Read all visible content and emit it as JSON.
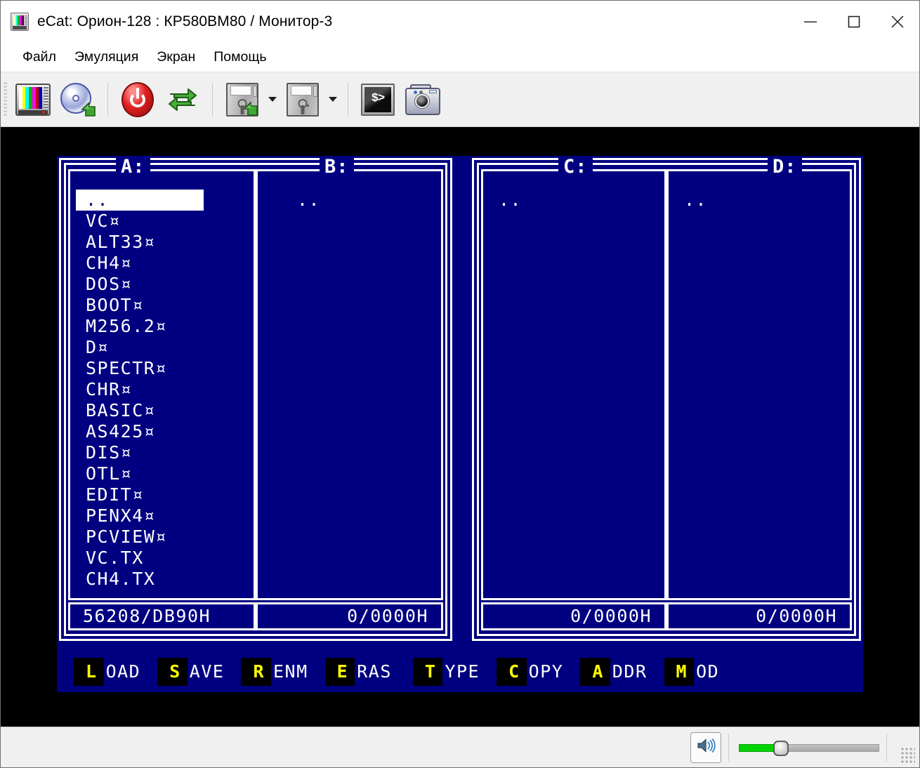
{
  "window": {
    "title": "eCat: Орион-128 : КР580ВМ80 / Монитор-3",
    "app_icon": "tv-monitor-icon",
    "controls": {
      "minimize": "minimize-icon",
      "maximize": "maximize-icon",
      "close": "close-icon"
    }
  },
  "menubar": {
    "items": [
      {
        "label": "Файл"
      },
      {
        "label": "Эмуляция"
      },
      {
        "label": "Экран"
      },
      {
        "label": "Помощь"
      }
    ]
  },
  "toolbar": {
    "buttons": [
      {
        "icon": "tv-monitor-icon",
        "name": "screen-settings-button"
      },
      {
        "icon": "cd-load-icon",
        "name": "load-disk-image-button"
      },
      {
        "icon": "power-icon",
        "name": "power-button"
      },
      {
        "icon": "reset-sync-icon",
        "name": "reset-button"
      },
      {
        "icon": "floppy-load-icon",
        "name": "mount-floppy-button",
        "has_dropdown": true
      },
      {
        "icon": "floppy-icon",
        "name": "floppy-select-button",
        "has_dropdown": true
      },
      {
        "icon": "console-icon",
        "name": "console-button"
      },
      {
        "icon": "camera-icon",
        "name": "screenshot-button"
      }
    ]
  },
  "emulator": {
    "background": "#000000",
    "screen_color": "#000080",
    "text_color": "#ffffff",
    "accent_color": "#ffff00",
    "groups": [
      {
        "name": "group-ab",
        "captions": [
          {
            "label": "A:"
          },
          {
            "label": "B:"
          }
        ],
        "columns": [
          {
            "drive": "A:",
            "align": "left",
            "entries": [
              {
                "label": "..",
                "selected": true
              },
              {
                "label": "VC¤"
              },
              {
                "label": "ALT33¤"
              },
              {
                "label": "CH4¤"
              },
              {
                "label": "DOS¤"
              },
              {
                "label": "BOOT¤"
              },
              {
                "label": "M256.2¤"
              },
              {
                "label": "D¤"
              },
              {
                "label": "SPECTR¤"
              },
              {
                "label": "CHR¤"
              },
              {
                "label": "BASIC¤"
              },
              {
                "label": "AS425¤"
              },
              {
                "label": "DIS¤"
              },
              {
                "label": "OTL¤"
              },
              {
                "label": "EDIT¤"
              },
              {
                "label": "PENX4¤"
              },
              {
                "label": "PCVIEW¤"
              },
              {
                "label": "VC.TX"
              },
              {
                "label": "CH4.TX"
              }
            ],
            "status": "56208/DB90H",
            "status_align": "left"
          },
          {
            "drive": "B:",
            "align": "right",
            "entries": [
              {
                "label": "..",
                "selected": false
              }
            ],
            "status": "0/0000H",
            "status_align": "right"
          }
        ]
      },
      {
        "name": "group-cd",
        "captions": [
          {
            "label": "C:"
          },
          {
            "label": "D:"
          }
        ],
        "columns": [
          {
            "drive": "C:",
            "align": "left",
            "entries": [
              {
                "label": "..",
                "selected": false
              }
            ],
            "status": "0/0000H",
            "status_align": "right"
          },
          {
            "drive": "D:",
            "align": "left",
            "entries": [
              {
                "label": "..",
                "selected": false
              }
            ],
            "status": "0/0000H",
            "status_align": "right"
          }
        ]
      }
    ],
    "function_keys": [
      {
        "key": "L",
        "rest": "OAD"
      },
      {
        "key": "S",
        "rest": "AVE"
      },
      {
        "key": "R",
        "rest": "ENM"
      },
      {
        "key": "E",
        "rest": "RAS"
      },
      {
        "key": "T",
        "rest": "YPE"
      },
      {
        "key": "C",
        "rest": "OPY"
      },
      {
        "key": "A",
        "rest": "DDR"
      },
      {
        "key": "M",
        "rest": "OD"
      }
    ]
  },
  "statusbar": {
    "speaker_icon": "speaker-volume-icon",
    "volume": {
      "value": 30,
      "min": 0,
      "max": 100,
      "fill_color": "#00d400"
    },
    "resize_grip": "resize-grip-icon"
  }
}
